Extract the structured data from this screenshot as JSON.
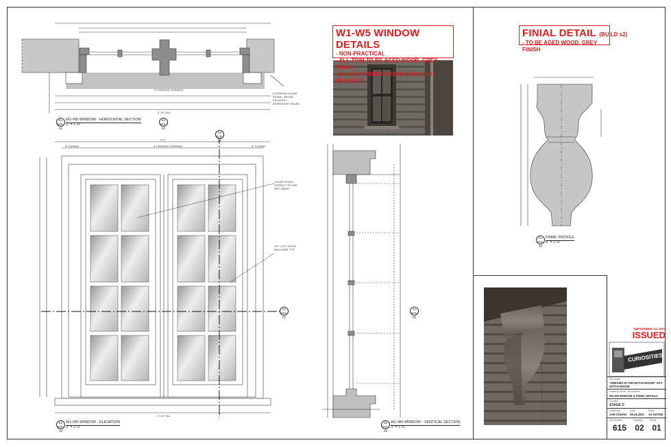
{
  "window_note": {
    "title": "W1-W5 WINDOW DETAILS",
    "lines": [
      "- NON-PRACTICAL",
      "- ALL TRIM TO BE AGED WOOD, GREY FINISH",
      "- WINDOW TRIM TO HAVE GAPS (NOT PERFECT)"
    ]
  },
  "finial_note": {
    "title": "FINIAL DETAIL",
    "title_suffix": "(BUILD x2)",
    "lines": [
      "- TO BE AGED WOOD, GREY FINISH"
    ]
  },
  "captions": {
    "horizontal": {
      "bubble_top": "S1",
      "bubble_bottom": "615-02",
      "title": "W1-W5 WINDOW - HORIZONTAL SECTION",
      "scale": "3\" = 1'-0\""
    },
    "elevation": {
      "bubble_top": "E1",
      "bubble_bottom": "615-02",
      "title": "W1-W5 WINDOW - ELEVATION",
      "scale": "3\" = 1'-0\""
    },
    "vertical": {
      "bubble_top": "S2",
      "bubble_bottom": "615-02",
      "title": "W1-W5 WINDOW - VERTICAL SECTION",
      "scale": "3\" = 1'-0\""
    },
    "finial": {
      "bubble_top": "F1",
      "bubble_bottom": "615-02",
      "title": "FINIAL PROFILE",
      "scale": "6\" = 1'-0\""
    }
  },
  "section_markers": {
    "s1": "S1",
    "s1_ref": "615-02",
    "s2": "S2",
    "s2_ref": "615-02"
  },
  "drawing_notes": {
    "exterior": "EXTERIOR HOUSE SIDING. REUSE FROM EXT. WORKSHOP HOUSE",
    "glass": "CLEAR GLASS, SCENICS TO ADD DIRT WASH",
    "mullions": "1/2\" x 1/2\" WOOD MULLIONS TYP.",
    "finished_opening": "3' FINISHED OPENING",
    "sill": "3' 10\" SILL",
    "casing": "4\" CASING",
    "overall": "3' 9\""
  },
  "issued": {
    "date": "SEPTEMBER 24, 2021",
    "label": "ISSUED"
  },
  "title_block": {
    "logo_text": "CURIOSITIES",
    "show_label": "Set Name",
    "show_name": "\"DREAMS IN THE WITCH HOUSE\" EXT. WITCH HOUSE",
    "drawing_label": "Drawing Name / Description",
    "location_label": "Location",
    "drawing_name": "W1-W5 WINDOW & FINIAL DETAILS",
    "stage": "STAGE D",
    "drawn_by_label": "Drawn By",
    "drawn_by": "JON COHAN",
    "date_label": "Date",
    "date": "08.24.2021",
    "scale_label": "Scale",
    "scale": "AS NOTED",
    "set_number_label": "Set Number",
    "set_number": "615",
    "drawing_label2": "Drawing",
    "drawing_number": "02",
    "sheet_label": "Sheet",
    "sheet_number": "01"
  },
  "colors": {
    "accent_red": "#e01b1b",
    "line": "#333333",
    "wall": "#b8b8b8"
  }
}
